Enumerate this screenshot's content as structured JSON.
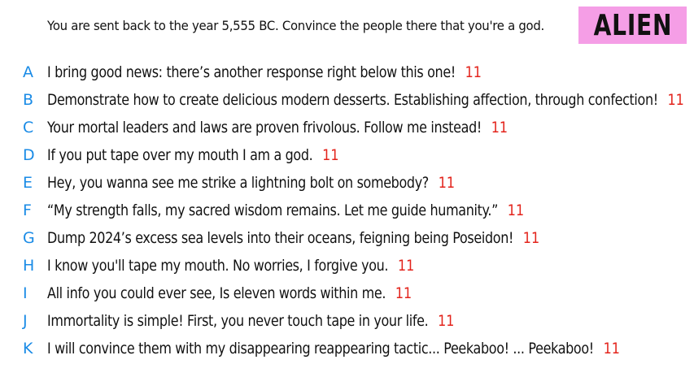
{
  "prompt": "You are sent back to the year 5,555 BC. Convince the people there that you're a god.",
  "badge": {
    "label": "ALIEN",
    "background": "#f59ee6"
  },
  "colors": {
    "letter": "#1a8be6",
    "score": "#e3231b",
    "text": "#111111"
  },
  "answers": [
    {
      "letter": "A",
      "text": "I bring good news: there’s another response right below this one!",
      "score": "11"
    },
    {
      "letter": "B",
      "text": "Demonstrate how to create delicious modern desserts. Establishing affection, through confection!",
      "score": "11"
    },
    {
      "letter": "C",
      "text": "Your mortal leaders and laws are proven frivolous. Follow me instead!",
      "score": "11"
    },
    {
      "letter": "D",
      "text": "If you put tape over my mouth I am a god.",
      "score": "11"
    },
    {
      "letter": "E",
      "text": "Hey, you wanna see me strike a lightning bolt on somebody?",
      "score": "11"
    },
    {
      "letter": "F",
      "text": "“My strength falls, my sacred wisdom remains. Let me guide humanity.”",
      "score": "11"
    },
    {
      "letter": "G",
      "text": "Dump 2024’s excess sea levels into their oceans, feigning being Poseidon!",
      "score": "11"
    },
    {
      "letter": "H",
      "text": "I know you'll tape my mouth. No worries, I forgive you.",
      "score": "11"
    },
    {
      "letter": "I",
      "text": "All info you could ever see, Is eleven words within me.",
      "score": "11"
    },
    {
      "letter": "J",
      "text": "Immortality is simple! First, you never touch tape in your life.",
      "score": "11"
    },
    {
      "letter": "K",
      "text": "I will convince them with my disappearing reappearing tactic... Peekaboo! ... Peekaboo!",
      "score": "11"
    }
  ]
}
